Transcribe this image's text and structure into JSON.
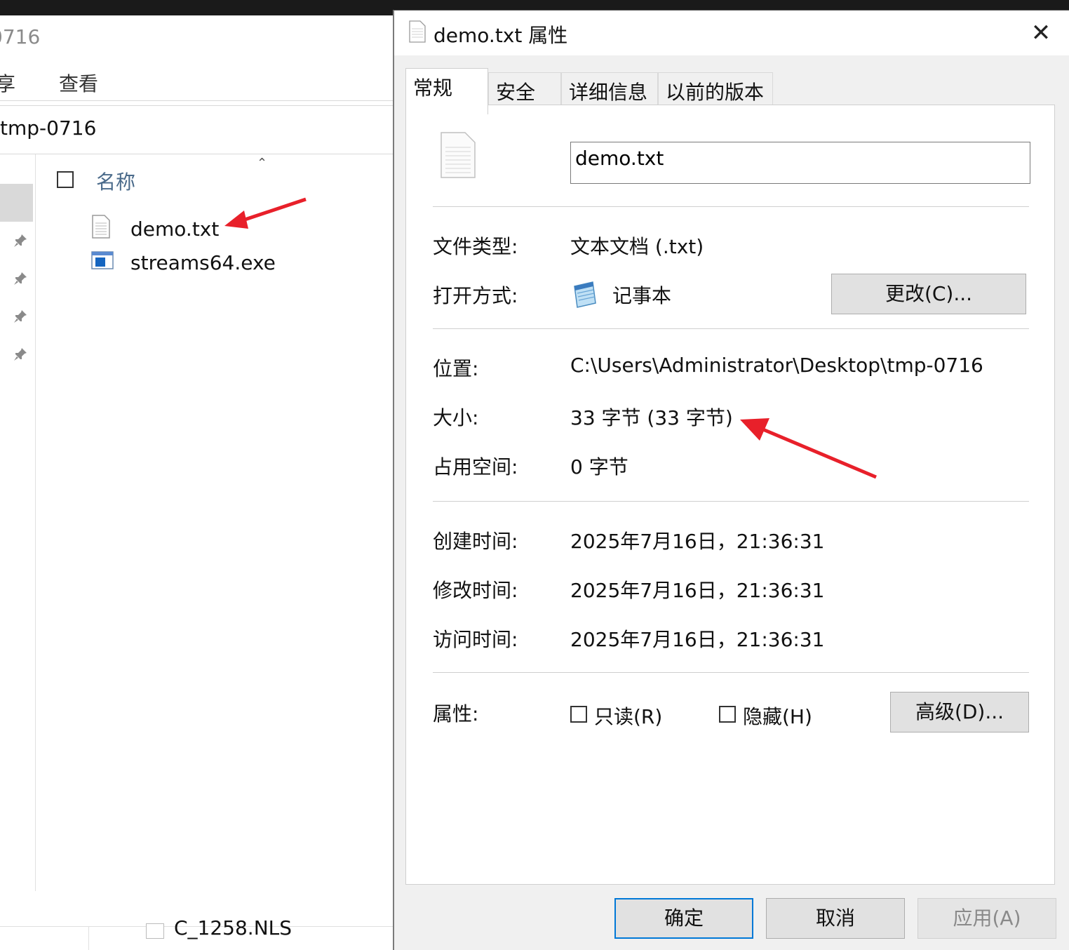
{
  "explorer": {
    "title_partial": "0716",
    "ribbon": {
      "share_partial": "享",
      "view": "查看"
    },
    "address_partial": "tmp-0716",
    "column_header": {
      "name": "名称"
    },
    "files": [
      {
        "name": "demo.txt",
        "icon": "text-file-icon"
      },
      {
        "name": "streams64.exe",
        "icon": "exe-file-icon"
      }
    ],
    "bottom_file_partial": "C_1258.NLS"
  },
  "dialog": {
    "title": "demo.txt 属性",
    "tabs": [
      "常规",
      "安全",
      "详细信息",
      "以前的版本"
    ],
    "active_tab": "常规",
    "filename": "demo.txt",
    "rows": {
      "file_type": {
        "label": "文件类型:",
        "value": "文本文档 (.txt)"
      },
      "opens_with": {
        "label": "打开方式:",
        "value": "记事本",
        "button": "更改(C)..."
      },
      "location": {
        "label": "位置:",
        "value": "C:\\Users\\Administrator\\Desktop\\tmp-0716"
      },
      "size": {
        "label": "大小:",
        "value": "33 字节 (33 字节)"
      },
      "size_on_disk": {
        "label": "占用空间:",
        "value": "0 字节"
      },
      "created": {
        "label": "创建时间:",
        "value": "2025年7月16日，21:36:31"
      },
      "modified": {
        "label": "修改时间:",
        "value": "2025年7月16日，21:36:31"
      },
      "accessed": {
        "label": "访问时间:",
        "value": "2025年7月16日，21:36:31"
      },
      "attributes": {
        "label": "属性:",
        "readonly": "只读(R)",
        "hidden": "隐藏(H)",
        "advanced": "高级(D)..."
      }
    },
    "buttons": {
      "ok": "确定",
      "cancel": "取消",
      "apply": "应用(A)"
    }
  },
  "annotations": {
    "arrow_color": "#e8202a"
  },
  "colors": {
    "dialog_bg": "#f0f0f0",
    "focus_border": "#0078d7"
  }
}
